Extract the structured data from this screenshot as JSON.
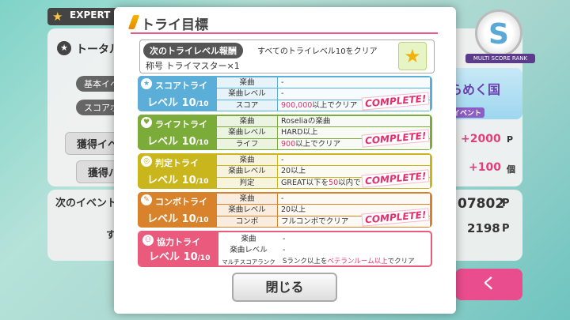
{
  "background": {
    "difficulty": "EXPERT",
    "total_label": "トータル",
    "basic_event_label": "基本イベ",
    "score_label": "スコアボ",
    "acquired_event_label": "獲得イベ",
    "acquired_pa_label": "獲得パ",
    "points_plus": "+2000",
    "points_unit": "P",
    "count_plus": "+100",
    "count_unit": "個",
    "next_event_label": "次のイベント",
    "big_value": "07802",
    "big_unit": "P",
    "value2": "2198",
    "value2_unit": "P",
    "score_rank": "MULTI SCORE RANK",
    "rank_letter": "S",
    "event_banner_text": "らめく国",
    "event_banner_sub": "イベント",
    "pink_button_char": "く",
    "side_char": "す"
  },
  "modal": {
    "title": "トライ目標",
    "reward": {
      "label": "次のトライレベル報酬",
      "condition": "すべてのトライレベル10をクリア",
      "item": "称号 トライマスター×1",
      "icon": "star-medal-icon"
    },
    "tries": [
      {
        "name": "スコアトライ",
        "level_prefix": "レベル",
        "level": "10",
        "level_max": "/10",
        "rows": [
          {
            "k": "楽曲",
            "v": "-"
          },
          {
            "k": "楽曲レベル",
            "v": "-"
          },
          {
            "k": "スコア",
            "v_hl": "900,000",
            "v": "以上でクリア"
          }
        ],
        "complete": "COMPLETE!",
        "color": "#5aaed8",
        "icon": "star-icon"
      },
      {
        "name": "ライフトライ",
        "level_prefix": "レベル",
        "level": "10",
        "level_max": "/10",
        "rows": [
          {
            "k": "楽曲",
            "v": "Roseliaの楽曲"
          },
          {
            "k": "楽曲レベル",
            "v": "HARD以上"
          },
          {
            "k": "ライフ",
            "v_hl": "900",
            "v": "以上でクリア"
          }
        ],
        "complete": "COMPLETE!",
        "color": "#7bab38",
        "icon": "heart-icon"
      },
      {
        "name": "判定トライ",
        "level_prefix": "レベル",
        "level": "10",
        "level_max": "/10",
        "rows": [
          {
            "k": "楽曲",
            "v": "-"
          },
          {
            "k": "楽曲レベル",
            "v": "20以上"
          },
          {
            "k": "判定",
            "v_pre": "GREAT以下を",
            "v_hl": "50",
            "v": "以内で"
          }
        ],
        "complete": "COMPLETE!",
        "color": "#c9b61c",
        "icon": "target-icon"
      },
      {
        "name": "コンボトライ",
        "level_prefix": "レベル",
        "level": "10",
        "level_max": "/10",
        "rows": [
          {
            "k": "楽曲",
            "v": "-"
          },
          {
            "k": "楽曲レベル",
            "v": "20以上"
          },
          {
            "k": "コンボ",
            "v": "フルコンボでクリア"
          }
        ],
        "complete": "COMPLETE!",
        "color": "#d9822c",
        "icon": "feather-icon"
      },
      {
        "name": "協力トライ",
        "level_prefix": "レベル",
        "level": "10",
        "level_max": "/10",
        "rows": [
          {
            "k": "楽曲",
            "v": "-"
          },
          {
            "k": "楽曲レベル",
            "v": "-"
          },
          {
            "k": "マルチスコアランク",
            "v_pre": "Sランク以上を",
            "v_hl": "ベテランルーム以上",
            "v": "でクリア"
          }
        ],
        "complete": "",
        "color": "#e95a7d",
        "icon": "people-icon"
      }
    ],
    "close_label": "閉じる"
  }
}
